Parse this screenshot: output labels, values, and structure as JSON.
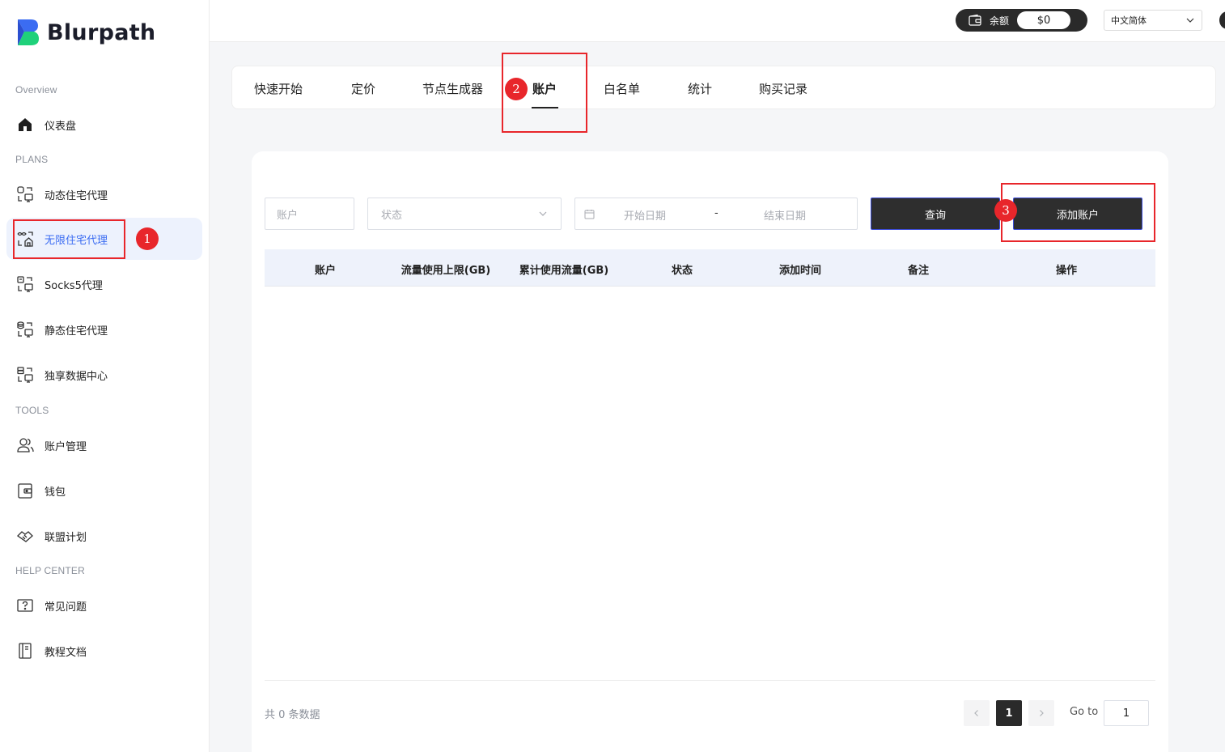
{
  "brand": {
    "name": "Blurpath",
    "accent": "#3b6cf2",
    "mark_color_top": "#3b6cf2",
    "mark_color_bottom": "#1fd17a"
  },
  "sidebar": {
    "sections": {
      "overview": "Overview",
      "plans": "PLANS",
      "tools": "TOOLS",
      "help": "HELP CENTER"
    },
    "items": [
      {
        "label": "仪表盘",
        "icon": "home-icon"
      },
      {
        "label": "动态住宅代理",
        "icon": "proxy-network-icon"
      },
      {
        "label": "无限住宅代理",
        "icon": "unlimited-proxy-icon",
        "active": true
      },
      {
        "label": "Socks5代理",
        "icon": "socks5-icon"
      },
      {
        "label": "静态住宅代理",
        "icon": "static-proxy-icon"
      },
      {
        "label": "独享数据中心",
        "icon": "datacenter-icon"
      },
      {
        "label": "账户管理",
        "icon": "users-icon"
      },
      {
        "label": "钱包",
        "icon": "wallet-icon"
      },
      {
        "label": "联盟计划",
        "icon": "handshake-icon"
      },
      {
        "label": "常见问题",
        "icon": "faq-icon"
      },
      {
        "label": "教程文档",
        "icon": "book-icon"
      }
    ]
  },
  "header": {
    "balance_label": "余额",
    "balance_value": "$0",
    "language": "中文简体"
  },
  "tabs": [
    {
      "label": "快速开始"
    },
    {
      "label": "定价"
    },
    {
      "label": "节点生成器"
    },
    {
      "label": "账户",
      "active": true
    },
    {
      "label": "白名单"
    },
    {
      "label": "统计"
    },
    {
      "label": "购买记录"
    }
  ],
  "filters": {
    "account_placeholder": "账户",
    "status_placeholder": "状态",
    "start_date_placeholder": "开始日期",
    "date_separator": "-",
    "end_date_placeholder": "结束日期",
    "query_button": "查询",
    "add_button": "添加账户"
  },
  "table": {
    "columns": [
      "账户",
      "流量使用上限(GB)",
      "累计使用流量(GB)",
      "状态",
      "添加时间",
      "备注",
      "操作"
    ],
    "rows": []
  },
  "pagination": {
    "total_text": "共 0 条数据",
    "current_page": "1",
    "goto_label": "Go to",
    "goto_value": "1"
  },
  "annotations": {
    "step1": "1",
    "step2": "2",
    "step3": "3",
    "highlight_color": "#e8262b"
  }
}
